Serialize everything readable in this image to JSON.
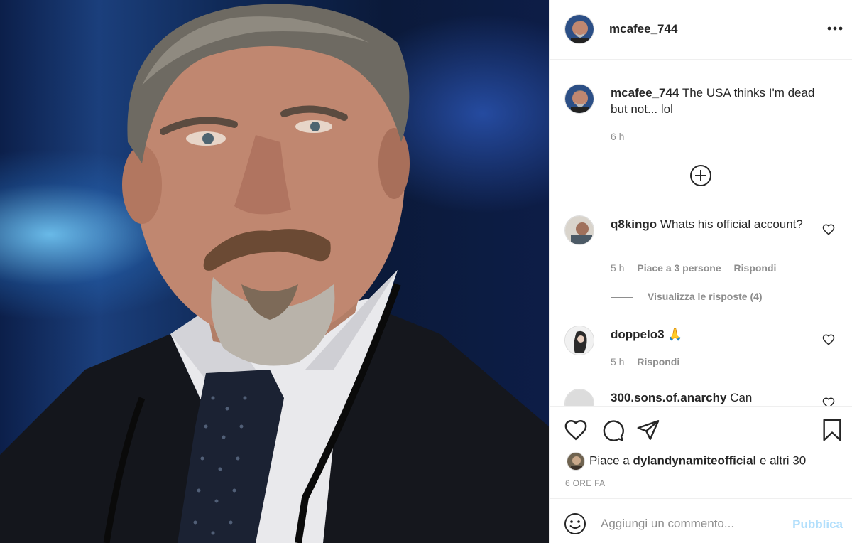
{
  "post": {
    "author": "mcafee_744",
    "caption": {
      "username": "mcafee_744",
      "text": "The USA thinks I'm dead but not... lol",
      "time": "6 h"
    },
    "icons": {
      "more": "more-horizontal-icon",
      "load_more": "plus-circle-icon"
    }
  },
  "comments": [
    {
      "username": "q8kingo",
      "text": "Whats his official account?",
      "time": "5 h",
      "likes_label": "Piace a 3 persone",
      "reply_label": "Rispondi",
      "view_replies": "Visualizza le risposte (4)"
    },
    {
      "username": "doppelo3",
      "text": "🙏",
      "time": "5 h",
      "reply_label": "Rispondi"
    },
    {
      "username": "300.sons.of.anarchy",
      "text": "Can"
    }
  ],
  "actions": {
    "icons": [
      "heart-icon",
      "comment-icon",
      "share-icon",
      "bookmark-icon"
    ],
    "likes_prefix": "Piace a",
    "likes_user": "dylandynamiteofficial",
    "likes_suffix": "e altri 30",
    "date": "6 ORE FA"
  },
  "add_comment": {
    "placeholder": "Aggiungi un commento...",
    "publish_label": "Pubblica",
    "emoji_icon": "emoji-icon"
  },
  "colors": {
    "text": "#262626",
    "secondary": "#8e8e8e",
    "border": "#efefef",
    "publish_disabled": "#b2dffc"
  }
}
